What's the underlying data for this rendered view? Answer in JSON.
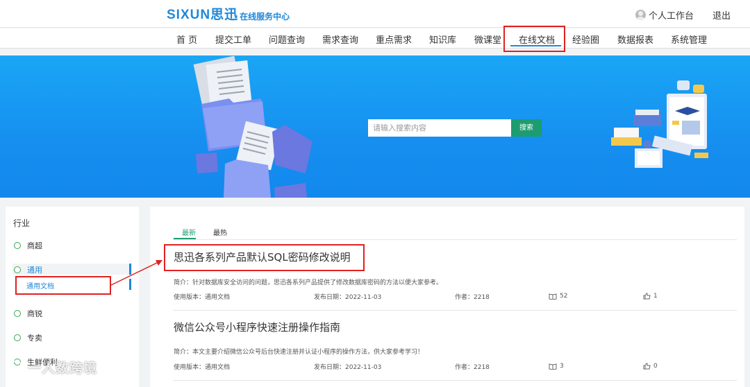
{
  "header": {
    "logo_main": "SIXUN思迅",
    "logo_sub": "在线服务中心",
    "workspace_label": "个人工作台",
    "logout_label": "退出"
  },
  "nav": {
    "items": [
      "首 页",
      "提交工单",
      "问题查询",
      "需求查询",
      "重点需求",
      "知识库",
      "微课堂",
      "在线文档",
      "经验圈",
      "数据报表",
      "系统管理"
    ],
    "active": "在线文档"
  },
  "search": {
    "placeholder": "请输入搜索内容",
    "button_label": "搜索"
  },
  "sidebar": {
    "title": "行业",
    "items": [
      "商超",
      "通用",
      "商锐",
      "专卖",
      "生鲜便利"
    ],
    "active_item": "通用",
    "sub_items": [
      "通用文档"
    ]
  },
  "tabs": [
    "最新",
    "最热"
  ],
  "articles": [
    {
      "title": "思迅各系列产品默认SQL密码修改说明",
      "desc": "简介：针对数据库安全访问的问题，思迅各系列产品提供了修改数据库密码的方法以便大家参考。",
      "version": "使用版本：通用文档",
      "date": "发布日期：2022-11-03",
      "author": "作者：2218",
      "views": "52",
      "likes": "1"
    },
    {
      "title": "微信公众号小程序快速注册操作指南",
      "desc": "简介：本文主要介绍微信公众号后台快速注册并认证小程序的操作方法，供大家参考学习！",
      "version": "使用版本：通用文档",
      "date": "发布日期：2022-11-03",
      "author": "作者：2218",
      "views": "3",
      "likes": "0"
    }
  ],
  "watermark": "一人数跨境",
  "colors": {
    "brand": "#1e88d8",
    "accent_green": "#1d9c6f",
    "highlight_red": "#e02020",
    "banner": "#168ff0"
  }
}
